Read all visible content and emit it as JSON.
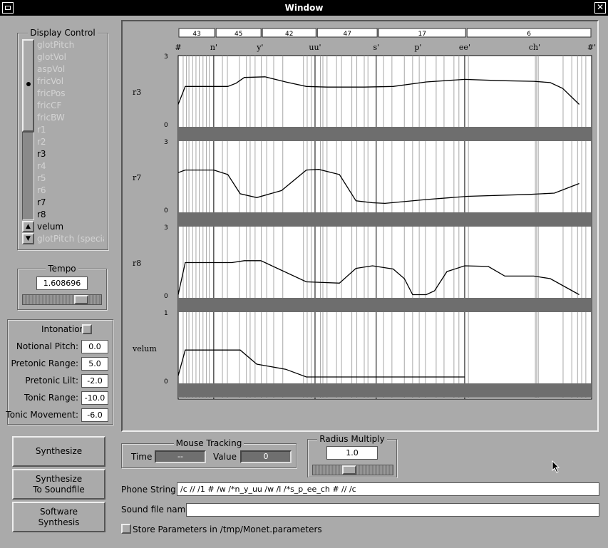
{
  "window": {
    "title": "Window"
  },
  "display_control": {
    "title": "Display Control",
    "items": [
      {
        "label": "glotPitch",
        "active": false
      },
      {
        "label": "glotVol",
        "active": false
      },
      {
        "label": "aspVol",
        "active": false
      },
      {
        "label": "fricVol",
        "active": false
      },
      {
        "label": "fricPos",
        "active": false
      },
      {
        "label": "fricCF",
        "active": false
      },
      {
        "label": "fricBW",
        "active": false
      },
      {
        "label": "r1",
        "active": false
      },
      {
        "label": "r2",
        "active": false
      },
      {
        "label": "r3",
        "active": true
      },
      {
        "label": "r4",
        "active": false
      },
      {
        "label": "r5",
        "active": false
      },
      {
        "label": "r6",
        "active": false
      },
      {
        "label": "r7",
        "active": true
      },
      {
        "label": "r8",
        "active": true
      },
      {
        "label": "velum",
        "active": true
      },
      {
        "label": "glotPitch (specia",
        "active": false
      }
    ]
  },
  "tempo": {
    "title": "Tempo",
    "value": "1.608696",
    "slider_fraction": 0.8
  },
  "intonation": {
    "checkbox_label": "Intonation",
    "fields": [
      {
        "label": "Notional Pitch:",
        "value": "0.0"
      },
      {
        "label": "Pretonic Range:",
        "value": "5.0"
      },
      {
        "label": "Pretonic Lilt:",
        "value": "-2.0"
      },
      {
        "label": "Tonic Range:",
        "value": "-10.0"
      },
      {
        "label": "Tonic Movement:",
        "value": "-6.0"
      }
    ]
  },
  "buttons": {
    "synthesize": "Synthesize",
    "synth_soundfile_1": "Synthesize",
    "synth_soundfile_2": "To Soundfile",
    "software_1": "Software",
    "software_2": "Synthesis"
  },
  "mouse_tracking": {
    "title": "Mouse Tracking",
    "time_label": "Time",
    "time_value": "--",
    "value_label": "Value",
    "value_value": "0"
  },
  "radius_multiply": {
    "title": "Radius Multiply",
    "value": "1.0",
    "slider_fraction": 0.45
  },
  "phone_string": {
    "label": "Phone String",
    "value": "/c // /1 # /w /*n_y_uu /w /l /*s_p_ee_ch # // /c"
  },
  "sound_file": {
    "label": "Sound file name",
    "value": ""
  },
  "store_params": {
    "label": "Store Parameters in /tmp/Monet.parameters",
    "checked": false
  },
  "chart_data": {
    "type": "line",
    "duration_units": [
      {
        "label": "43",
        "start": 0.0,
        "end": 0.09
      },
      {
        "label": "45",
        "start": 0.09,
        "end": 0.202
      },
      {
        "label": "42",
        "start": 0.202,
        "end": 0.335
      },
      {
        "label": "47",
        "start": 0.335,
        "end": 0.483
      },
      {
        "label": "17",
        "start": 0.483,
        "end": 0.697
      },
      {
        "label": "6",
        "start": 0.697,
        "end": 1.0
      }
    ],
    "phones": [
      {
        "label": "#",
        "t": 0.0
      },
      {
        "label": "n'",
        "t": 0.086
      },
      {
        "label": "y'",
        "t": 0.198
      },
      {
        "label": "uu'",
        "t": 0.331
      },
      {
        "label": "s'",
        "t": 0.479
      },
      {
        "label": "p'",
        "t": 0.58
      },
      {
        "label": "ee'",
        "t": 0.693
      },
      {
        "label": "ch'",
        "t": 0.862
      },
      {
        "label": "#'",
        "t": 1.0
      }
    ],
    "major_lines": [
      0.0,
      0.086,
      0.331,
      0.479,
      0.693,
      1.0
    ],
    "minor_lines": [
      0.012,
      0.02,
      0.026,
      0.035,
      0.043,
      0.051,
      0.06,
      0.068,
      0.075,
      0.107,
      0.119,
      0.148,
      0.165,
      0.174,
      0.186,
      0.201,
      0.214,
      0.231,
      0.253,
      0.303,
      0.312,
      0.322,
      0.344,
      0.35,
      0.36,
      0.383,
      0.395,
      0.42,
      0.432,
      0.45,
      0.459,
      0.497,
      0.517,
      0.547,
      0.567,
      0.583,
      0.598,
      0.624,
      0.643,
      0.667,
      0.679,
      0.702,
      0.864,
      0.867,
      0.871,
      0.931,
      0.952,
      0.966,
      0.976,
      0.986
    ],
    "series": [
      {
        "name": "r3",
        "ymin": 0,
        "ymax": 3,
        "points": [
          [
            0.0,
            0.35
          ],
          [
            0.017,
            0.63
          ],
          [
            0.05,
            0.63
          ],
          [
            0.086,
            0.63
          ],
          [
            0.12,
            0.63
          ],
          [
            0.14,
            0.68
          ],
          [
            0.16,
            0.77
          ],
          [
            0.21,
            0.78
          ],
          [
            0.26,
            0.7
          ],
          [
            0.31,
            0.63
          ],
          [
            0.36,
            0.62
          ],
          [
            0.45,
            0.62
          ],
          [
            0.52,
            0.63
          ],
          [
            0.6,
            0.7
          ],
          [
            0.693,
            0.74
          ],
          [
            0.78,
            0.72
          ],
          [
            0.86,
            0.71
          ],
          [
            0.9,
            0.69
          ],
          [
            0.93,
            0.6
          ],
          [
            0.97,
            0.35
          ]
        ]
      },
      {
        "name": "r7",
        "ymin": 0,
        "ymax": 3,
        "points": [
          [
            0.0,
            0.62
          ],
          [
            0.017,
            0.66
          ],
          [
            0.05,
            0.66
          ],
          [
            0.086,
            0.66
          ],
          [
            0.12,
            0.59
          ],
          [
            0.15,
            0.29
          ],
          [
            0.19,
            0.23
          ],
          [
            0.25,
            0.34
          ],
          [
            0.31,
            0.66
          ],
          [
            0.34,
            0.67
          ],
          [
            0.39,
            0.59
          ],
          [
            0.43,
            0.18
          ],
          [
            0.47,
            0.15
          ],
          [
            0.5,
            0.14
          ],
          [
            0.6,
            0.2
          ],
          [
            0.7,
            0.25
          ],
          [
            0.85,
            0.28
          ],
          [
            0.91,
            0.3
          ],
          [
            0.97,
            0.45
          ]
        ]
      },
      {
        "name": "r8",
        "ymin": 0,
        "ymax": 3,
        "points": [
          [
            0.0,
            0.05
          ],
          [
            0.017,
            0.55
          ],
          [
            0.086,
            0.55
          ],
          [
            0.13,
            0.55
          ],
          [
            0.16,
            0.58
          ],
          [
            0.2,
            0.58
          ],
          [
            0.24,
            0.46
          ],
          [
            0.31,
            0.25
          ],
          [
            0.35,
            0.24
          ],
          [
            0.39,
            0.23
          ],
          [
            0.43,
            0.46
          ],
          [
            0.47,
            0.5
          ],
          [
            0.52,
            0.45
          ],
          [
            0.547,
            0.3
          ],
          [
            0.567,
            0.05
          ],
          [
            0.6,
            0.05
          ],
          [
            0.62,
            0.11
          ],
          [
            0.65,
            0.41
          ],
          [
            0.693,
            0.5
          ],
          [
            0.75,
            0.49
          ],
          [
            0.79,
            0.34
          ],
          [
            0.86,
            0.34
          ],
          [
            0.9,
            0.3
          ],
          [
            0.97,
            0.05
          ]
        ]
      },
      {
        "name": "velum",
        "ymin": 0,
        "ymax": 1,
        "points": [
          [
            0.0,
            0.12
          ],
          [
            0.017,
            0.52
          ],
          [
            0.05,
            0.52
          ],
          [
            0.086,
            0.52
          ],
          [
            0.15,
            0.52
          ],
          [
            0.19,
            0.3
          ],
          [
            0.26,
            0.22
          ],
          [
            0.31,
            0.1
          ],
          [
            0.331,
            0.1
          ],
          [
            0.693,
            0.1
          ]
        ]
      }
    ],
    "ylabels": [
      {
        "top": "3",
        "bottom": "0"
      },
      {
        "top": "3",
        "bottom": "0"
      },
      {
        "top": "3",
        "bottom": "0"
      },
      {
        "top": "1",
        "bottom": "0"
      }
    ]
  }
}
